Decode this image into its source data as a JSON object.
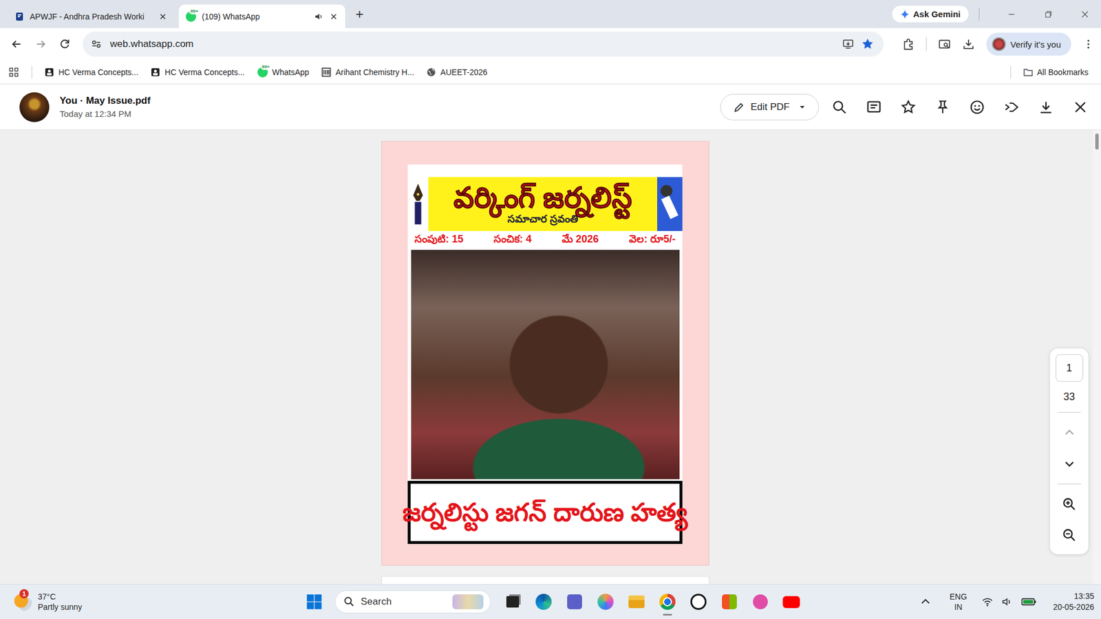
{
  "browser": {
    "tabs": [
      {
        "title": "APWJF - Andhra Pradesh Worki",
        "selected": false,
        "badge": "",
        "audio": false
      },
      {
        "title": "(109) WhatsApp",
        "selected": true,
        "badge": "99+",
        "audio": true
      }
    ],
    "new_tab": "+",
    "gemini": "Ask Gemini",
    "url": "web.whatsapp.com",
    "bookmarked": true,
    "profile": "Verify it's you",
    "bookmarks": [
      {
        "label": "HC Verma Concepts...",
        "kind": "book",
        "badge": ""
      },
      {
        "label": "HC Verma Concepts...",
        "kind": "book",
        "badge": ""
      },
      {
        "label": "WhatsApp",
        "kind": "whatsapp",
        "badge": "99+"
      },
      {
        "label": "Arihant Chemistry H...",
        "kind": "library",
        "badge": ""
      },
      {
        "label": "AUEET-2026",
        "kind": "globe",
        "badge": ""
      }
    ],
    "all_bookmarks": "All Bookmarks"
  },
  "viewer": {
    "title": "You · May Issue.pdf",
    "time": "Today at 12:34 PM",
    "edit_button": "Edit PDF"
  },
  "document": {
    "masthead": "వర్కింగ్ జర్నలిస్ట్",
    "tagline": "సమాచార స్రవంతి",
    "issue_line": [
      "సంపుటి: 15",
      "సంచిక: 4",
      "మే 2026",
      "వెల: రూ5/-"
    ],
    "headline": "జర్నలిస్టు జగన్ దారుణ హత్య"
  },
  "pager": {
    "current_page": "1",
    "total_pages": "33"
  },
  "taskbar": {
    "weather_badge": "1",
    "temperature": "37°C",
    "weather": "Partly sunny",
    "search": "Search",
    "language": "ENG",
    "region": "IN",
    "time": "13:35",
    "date": "20-05-2026"
  }
}
